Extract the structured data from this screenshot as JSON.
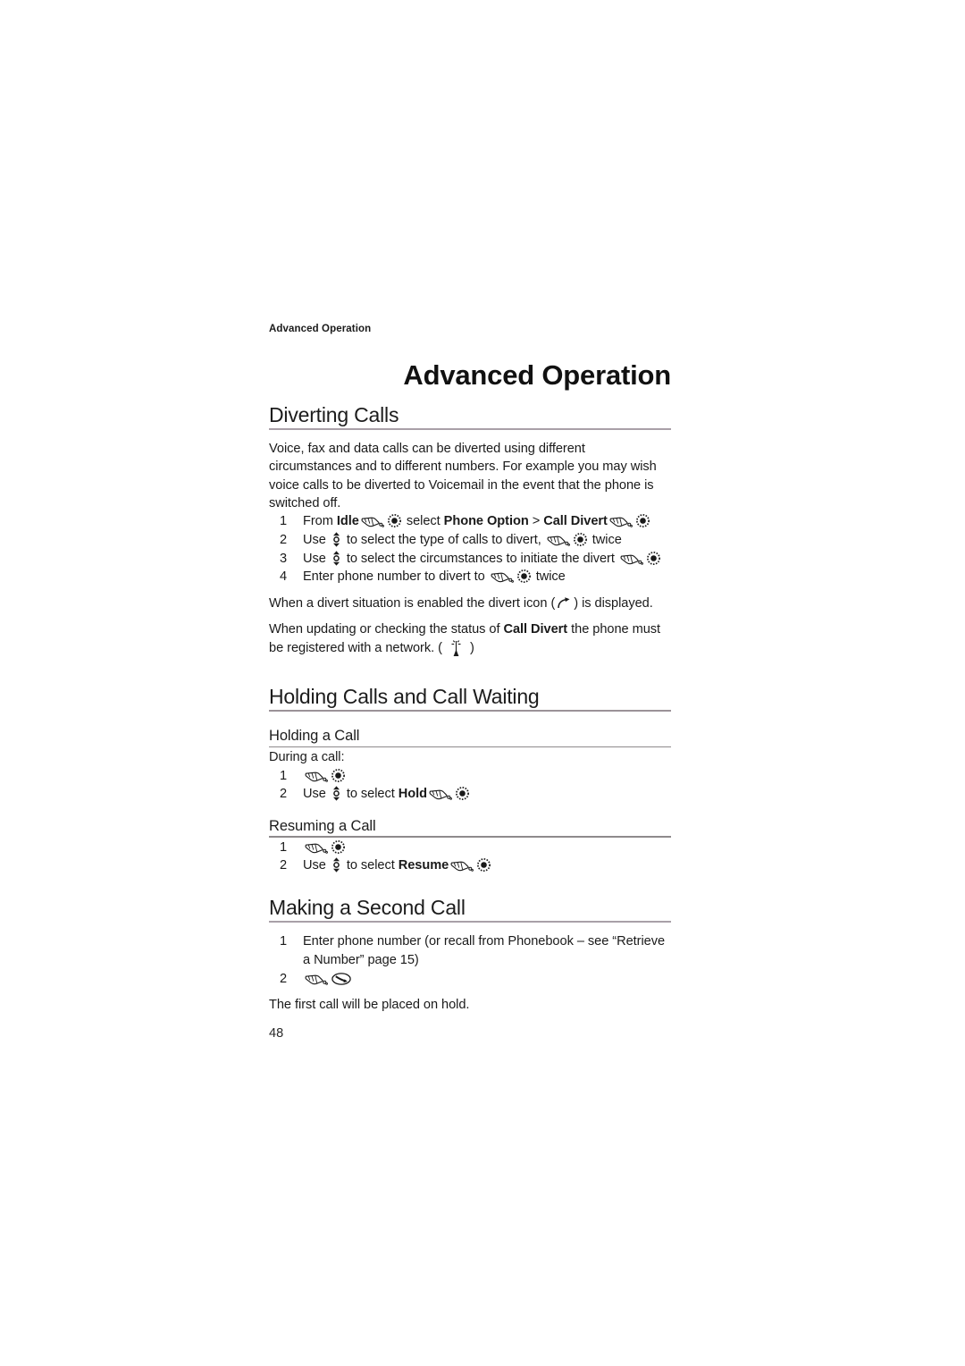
{
  "document": {
    "running_header": "Advanced Operation",
    "chapter_title": "Advanced Operation",
    "page_number": "48"
  },
  "sections": {
    "diverting_calls": {
      "heading": "Diverting Calls",
      "intro": "Voice, fax and data calls can be diverted using different circumstances and to different numbers. For example you may wish voice calls to be diverted to Voicemail in the event that the phone is switched off.",
      "steps": [
        {
          "number": "1",
          "parts": [
            {
              "type": "text",
              "value": "From "
            },
            {
              "type": "bold",
              "value": "Idle"
            },
            {
              "type": "icon",
              "value": "hand-icon"
            },
            {
              "type": "icon",
              "value": "select-button-icon"
            },
            {
              "type": "text",
              "value": " select "
            },
            {
              "type": "bold",
              "value": "Phone Option"
            },
            {
              "type": "text",
              "value": " > "
            },
            {
              "type": "bold",
              "value": "Call Divert"
            },
            {
              "type": "icon",
              "value": "hand-icon"
            },
            {
              "type": "icon",
              "value": "select-button-icon"
            }
          ]
        },
        {
          "number": "2",
          "parts": [
            {
              "type": "text",
              "value": "Use "
            },
            {
              "type": "icon",
              "value": "up-down-key-icon"
            },
            {
              "type": "text",
              "value": " to select the type of calls to divert, "
            },
            {
              "type": "icon",
              "value": "hand-icon"
            },
            {
              "type": "icon",
              "value": "select-button-icon"
            },
            {
              "type": "text",
              "value": " twice"
            }
          ]
        },
        {
          "number": "3",
          "parts": [
            {
              "type": "text",
              "value": "Use "
            },
            {
              "type": "icon",
              "value": "up-down-key-icon"
            },
            {
              "type": "text",
              "value": " to select the circumstances to initiate the divert "
            },
            {
              "type": "icon",
              "value": "hand-icon"
            },
            {
              "type": "icon",
              "value": "select-button-icon"
            }
          ]
        },
        {
          "number": "4",
          "parts": [
            {
              "type": "text",
              "value": "Enter phone number to divert to "
            },
            {
              "type": "icon",
              "value": "hand-icon"
            },
            {
              "type": "icon",
              "value": "select-button-icon"
            },
            {
              "type": "text",
              "value": " twice"
            }
          ]
        }
      ],
      "note_divert_before": "When a divert situation is enabled the divert icon (",
      "note_divert_after": ") is displayed.",
      "note_network_a": "When updating or checking the status of ",
      "note_network_bold": "Call Divert",
      "note_network_b": " the phone must be registered with a network. ( ",
      "note_network_c": " )"
    },
    "holding_calls": {
      "heading": "Holding Calls and Call Waiting",
      "holding_a_call": {
        "heading": "Holding a Call",
        "intro": "During a call:",
        "steps": [
          {
            "number": "1",
            "parts": [
              {
                "type": "icon",
                "value": "hand-icon"
              },
              {
                "type": "icon",
                "value": "select-button-icon"
              }
            ]
          },
          {
            "number": "2",
            "parts": [
              {
                "type": "text",
                "value": "Use "
              },
              {
                "type": "icon",
                "value": "up-down-key-icon"
              },
              {
                "type": "text",
                "value": " to select "
              },
              {
                "type": "bold",
                "value": "Hold"
              },
              {
                "type": "icon",
                "value": "hand-icon"
              },
              {
                "type": "icon",
                "value": "select-button-icon"
              }
            ]
          }
        ]
      },
      "resuming_a_call": {
        "heading": "Resuming a Call",
        "steps": [
          {
            "number": "1",
            "parts": [
              {
                "type": "icon",
                "value": "hand-icon"
              },
              {
                "type": "icon",
                "value": "select-button-icon"
              }
            ]
          },
          {
            "number": "2",
            "parts": [
              {
                "type": "text",
                "value": "Use "
              },
              {
                "type": "icon",
                "value": "up-down-key-icon"
              },
              {
                "type": "text",
                "value": " to select "
              },
              {
                "type": "bold",
                "value": "Resume"
              },
              {
                "type": "icon",
                "value": "hand-icon"
              },
              {
                "type": "icon",
                "value": "select-button-icon"
              }
            ]
          }
        ]
      }
    },
    "making_second_call": {
      "heading": "Making a Second Call",
      "steps": [
        {
          "number": "1",
          "parts": [
            {
              "type": "text",
              "value": "Enter phone number (or recall from Phonebook – see “Retrieve a Number” page 15)"
            }
          ]
        },
        {
          "number": "2",
          "parts": [
            {
              "type": "icon",
              "value": "hand-icon"
            },
            {
              "type": "icon",
              "value": "send-key-icon"
            }
          ]
        }
      ],
      "closing": "The first call will be placed on hold."
    }
  },
  "colors": {
    "text": "#1a1a1a",
    "section_rule": "#a9a0a8",
    "subsection_rule": "#8e8a8c",
    "background": "#ffffff"
  }
}
